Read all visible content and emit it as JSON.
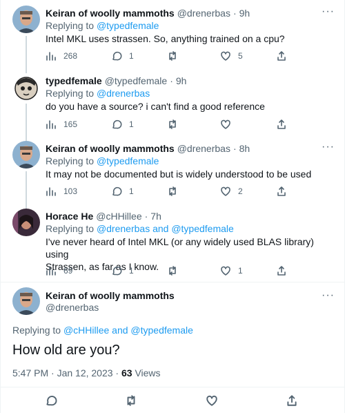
{
  "tweets": [
    {
      "name": "Keiran of woolly mammoths",
      "handle": "@drenerbas",
      "time": "9h",
      "replying_prefix": "Replying to ",
      "replying_to": "@typedfemale",
      "text": "Intel MKL uses strassen. So, anything trained on a cpu?",
      "views": "268",
      "replies": "1",
      "retweets": "",
      "likes": "5"
    },
    {
      "name": "typedfemale",
      "handle": "@typedfemale",
      "time": "9h",
      "replying_prefix": "Replying to ",
      "replying_to": "@drenerbas",
      "text": "do you have a source? i can't find a good reference",
      "views": "165",
      "replies": "1",
      "retweets": "",
      "likes": ""
    },
    {
      "name": "Keiran of woolly mammoths",
      "handle": "@drenerbas",
      "time": "8h",
      "replying_prefix": "Replying to ",
      "replying_to": "@typedfemale",
      "text": "It may not be documented but is widely understood to be used",
      "views": "103",
      "replies": "1",
      "retweets": "",
      "likes": "2"
    },
    {
      "name": "Horace He",
      "handle": "@cHHillee",
      "time": "7h",
      "replying_prefix": "Replying to ",
      "replying_to": "@drenerbas and @typedfemale",
      "text_line1": "I've never heard of Intel MKL (or any widely used BLAS library) using",
      "text_line2": "Strassen, as far as I know.",
      "views": "69",
      "replies": "1",
      "retweets": "",
      "likes": "1"
    }
  ],
  "focused": {
    "name": "Keiran of woolly mammoths",
    "handle": "@drenerbas",
    "replying_prefix": "Replying to ",
    "replying_to": "@cHHillee and @typedfemale",
    "text": "How old are you?",
    "timestamp": "5:47 PM · Jan 12, 2023 · ",
    "views_count": "63",
    "views_label": " Views"
  },
  "separator_dot": "·",
  "more_glyph": "···",
  "colors": {
    "link": "#1d9bf0",
    "secondary": "#536471",
    "primary": "#0f1419",
    "thread_line": "#cfd9de"
  },
  "icons": [
    "views-icon",
    "reply-icon",
    "retweet-icon",
    "like-icon",
    "share-icon",
    "more-icon"
  ]
}
